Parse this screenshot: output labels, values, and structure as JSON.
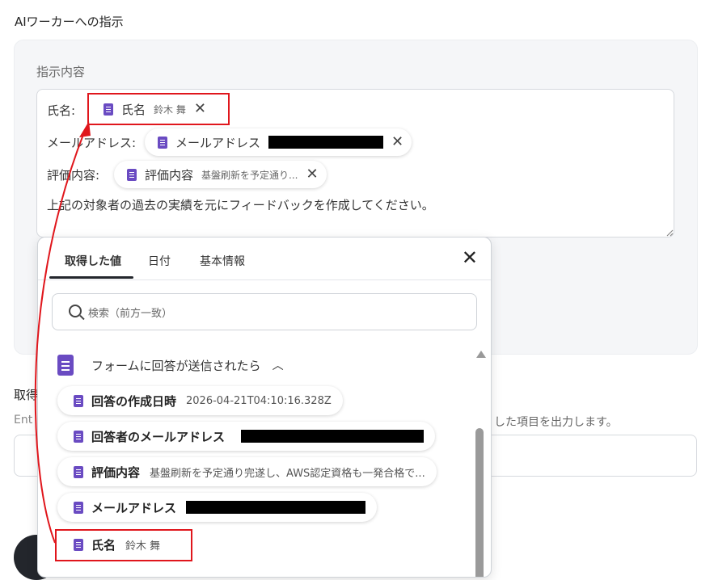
{
  "section_title": "AIワーカーへの指示",
  "field_label": "指示内容",
  "rows": [
    {
      "label": "氏名:",
      "chip_name": "氏名",
      "chip_value": "鈴木 舞"
    },
    {
      "label": "メールアドレス:",
      "chip_name": "メールアドレス",
      "chip_value": ""
    },
    {
      "label": "評価内容:",
      "chip_name": "評価内容",
      "chip_value": "基盤刷新を予定通り..."
    }
  ],
  "instruction_text": "上記の対象者の過去の実績を元にフィードバックを作成してください。",
  "background": {
    "label_partial": "取得",
    "desc_partial": "Ent",
    "desc_right": "した項目を出力します。"
  },
  "dropdown": {
    "tabs": [
      "取得した値",
      "日付",
      "基本情報"
    ],
    "active_tab": "取得した値",
    "search_placeholder": "検索（前方一致）",
    "group_title": "フォームに回答が送信されたら",
    "items": [
      {
        "key": "回答の作成日時",
        "value": "2026-04-21T04:10:16.328Z"
      },
      {
        "key": "回答者のメールアドレス",
        "value": ""
      },
      {
        "key": "評価内容",
        "value": "基盤刷新を予定通り完遂し、AWS認定資格も一発合格で..."
      },
      {
        "key": "メールアドレス",
        "value": ""
      },
      {
        "key": "氏名",
        "value": "鈴木 舞"
      }
    ]
  },
  "colors": {
    "highlight": "#e0161c",
    "doc_icon": "#6a4bc2"
  },
  "icons": [
    "doc-icon",
    "close-icon",
    "search-icon",
    "chevron-up-icon",
    "scroll-up-icon"
  ]
}
